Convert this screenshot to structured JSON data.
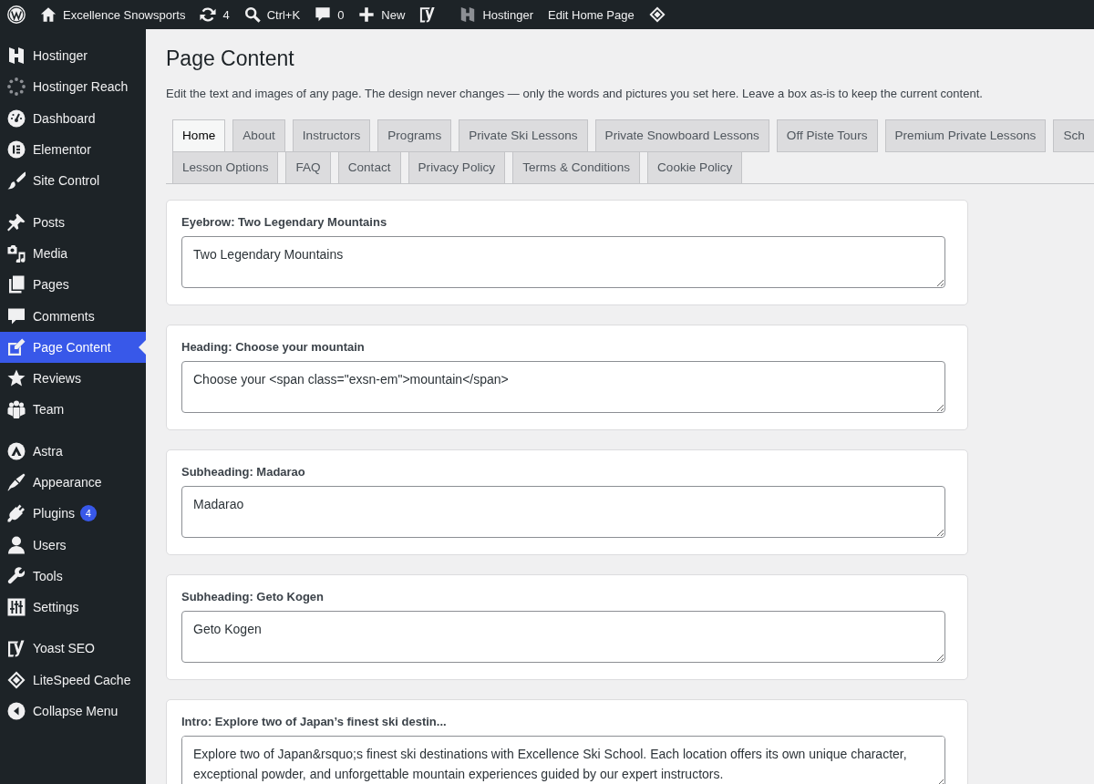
{
  "admin_bar": {
    "site_name": "Excellence Snowsports",
    "updates_count": "4",
    "search_shortcut": "Ctrl+K",
    "comments_count": "0",
    "new_label": "New",
    "hostinger_label": "Hostinger",
    "edit_label": "Edit Home Page"
  },
  "sidebar": {
    "groups": [
      {
        "items": [
          {
            "label": "Hostinger",
            "selected": false
          },
          {
            "label": "Hostinger Reach",
            "selected": false
          },
          {
            "label": "Dashboard",
            "selected": false
          },
          {
            "label": "Elementor",
            "selected": false
          },
          {
            "label": "Site Control",
            "selected": false
          }
        ]
      },
      {
        "items": [
          {
            "label": "Posts",
            "selected": false
          },
          {
            "label": "Media",
            "selected": false
          },
          {
            "label": "Pages",
            "selected": false
          },
          {
            "label": "Comments",
            "selected": false
          },
          {
            "label": "Page Content",
            "selected": true
          },
          {
            "label": "Reviews",
            "selected": false
          },
          {
            "label": "Team",
            "selected": false
          }
        ]
      },
      {
        "items": [
          {
            "label": "Astra",
            "selected": false
          },
          {
            "label": "Appearance",
            "selected": false
          },
          {
            "label": "Plugins",
            "selected": false,
            "badge": "4"
          },
          {
            "label": "Users",
            "selected": false
          },
          {
            "label": "Tools",
            "selected": false
          },
          {
            "label": "Settings",
            "selected": false
          }
        ]
      },
      {
        "items": [
          {
            "label": "Yoast SEO",
            "selected": false
          },
          {
            "label": "LiteSpeed Cache",
            "selected": false
          }
        ]
      }
    ],
    "collapse_label": "Collapse Menu"
  },
  "page": {
    "title": "Page Content",
    "description": "Edit the text and images of any page. The design never changes — only the words and pictures you set here. Leave a box as-is to keep the current content.",
    "tabs": [
      {
        "label": "Home",
        "selected": true
      },
      {
        "label": "About",
        "selected": false
      },
      {
        "label": "Instructors",
        "selected": false
      },
      {
        "label": "Programs",
        "selected": false
      },
      {
        "label": "Private Ski Lessons",
        "selected": false
      },
      {
        "label": "Private Snowboard Lessons",
        "selected": false
      },
      {
        "label": "Off Piste Tours",
        "selected": false
      },
      {
        "label": "Premium Private Lessons",
        "selected": false
      },
      {
        "label": "Sch",
        "selected": false
      },
      {
        "label": "Lesson Options",
        "selected": false
      },
      {
        "label": "FAQ",
        "selected": false
      },
      {
        "label": "Contact",
        "selected": false
      },
      {
        "label": "Privacy Policy",
        "selected": false
      },
      {
        "label": "Terms & Conditions",
        "selected": false
      },
      {
        "label": "Cookie Policy",
        "selected": false
      }
    ],
    "fields": [
      {
        "label": "Eyebrow: Two Legendary Mountains",
        "value": "Two Legendary Mountains"
      },
      {
        "label": "Heading: Choose your mountain",
        "value": "Choose your <span class=\"exsn-em\">mountain</span>"
      },
      {
        "label": "Subheading: Madarao",
        "value": "Madarao"
      },
      {
        "label": "Subheading: Geto Kogen",
        "value": "Geto Kogen"
      },
      {
        "label": "Intro: Explore two of Japan’s finest ski destin...",
        "value": "Explore two of Japan&rsquo;s finest ski destinations with Excellence Ski School. Each location offers its own unique character, exceptional powder, and unforgettable mountain experiences guided by our expert instructors."
      }
    ]
  }
}
